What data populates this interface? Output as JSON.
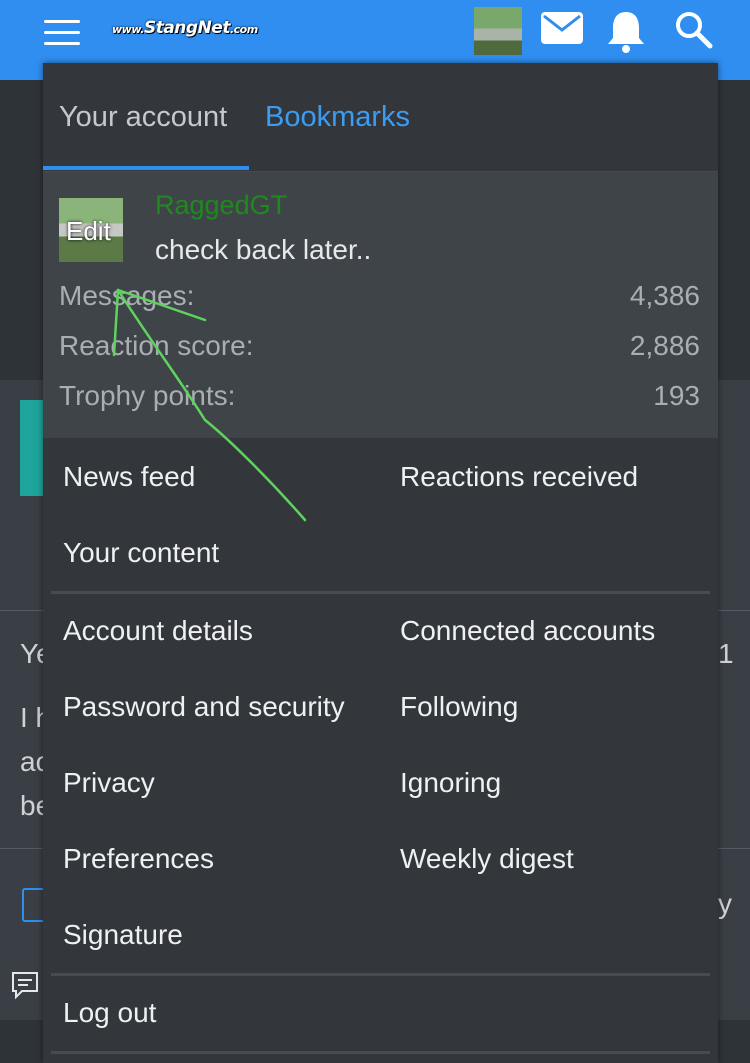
{
  "header": {
    "logo_prefix": "www.",
    "logo_text": "StangNet",
    "logo_suffix": ".com"
  },
  "tabs": [
    "Your account",
    "Bookmarks"
  ],
  "profile": {
    "username": "RaggedGT",
    "status": "check back later..",
    "avatar_edit": "Edit",
    "stats": [
      {
        "label": "Messages:",
        "value": "4,386"
      },
      {
        "label": "Reaction score:",
        "value": "2,886"
      },
      {
        "label": "Trophy points:",
        "value": "193"
      }
    ]
  },
  "menu": {
    "news_feed": "News feed",
    "reactions_received": "Reactions received",
    "your_content": "Your content",
    "account_details": "Account details",
    "connected_accounts": "Connected accounts",
    "password_security": "Password and security",
    "following": "Following",
    "privacy": "Privacy",
    "ignoring": "Ignoring",
    "preferences": "Preferences",
    "weekly_digest": "Weekly digest",
    "signature": "Signature",
    "log_out": "Log out"
  },
  "background": {
    "frag1": "Ye",
    "frag2": "I h",
    "frag3": "ac",
    "frag4": "be",
    "frag5": "1",
    "frag6": "y"
  },
  "colors": {
    "topbar": "#2f8ef0",
    "accent": "#3d9bf0",
    "username": "#1e8a1e",
    "arrow": "#5ed35e"
  }
}
